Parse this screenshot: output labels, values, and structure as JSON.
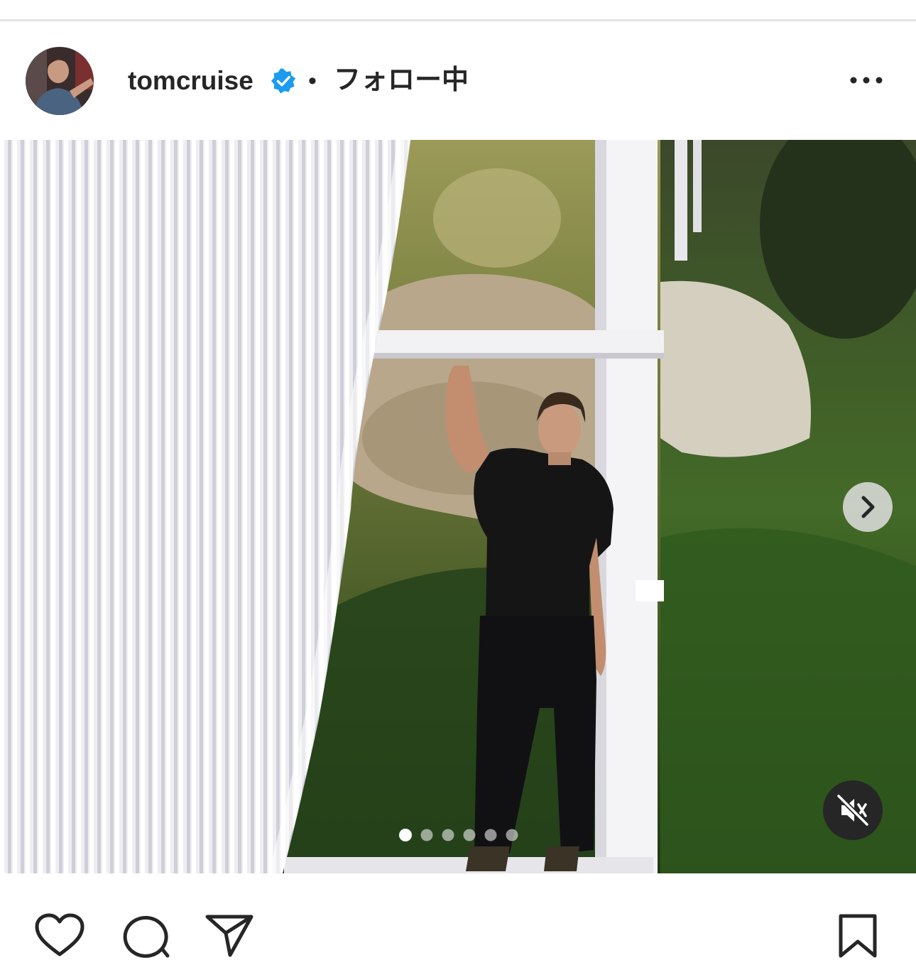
{
  "post": {
    "username": "tomcruise",
    "separator": "•",
    "follow_status": "フォロー中",
    "carousel": {
      "total_slides": 6,
      "current_slide": 1
    }
  },
  "icons": {
    "avatar": "profile-avatar",
    "verified": "verified-badge-icon",
    "more": "more-options-icon",
    "next": "chevron-right-icon",
    "mute": "speaker-muted-icon",
    "like": "heart-icon",
    "comment": "comment-icon",
    "share": "paper-plane-icon",
    "save": "bookmark-icon"
  },
  "colors": {
    "verified": "#1d9bf0",
    "text": "#262626"
  }
}
